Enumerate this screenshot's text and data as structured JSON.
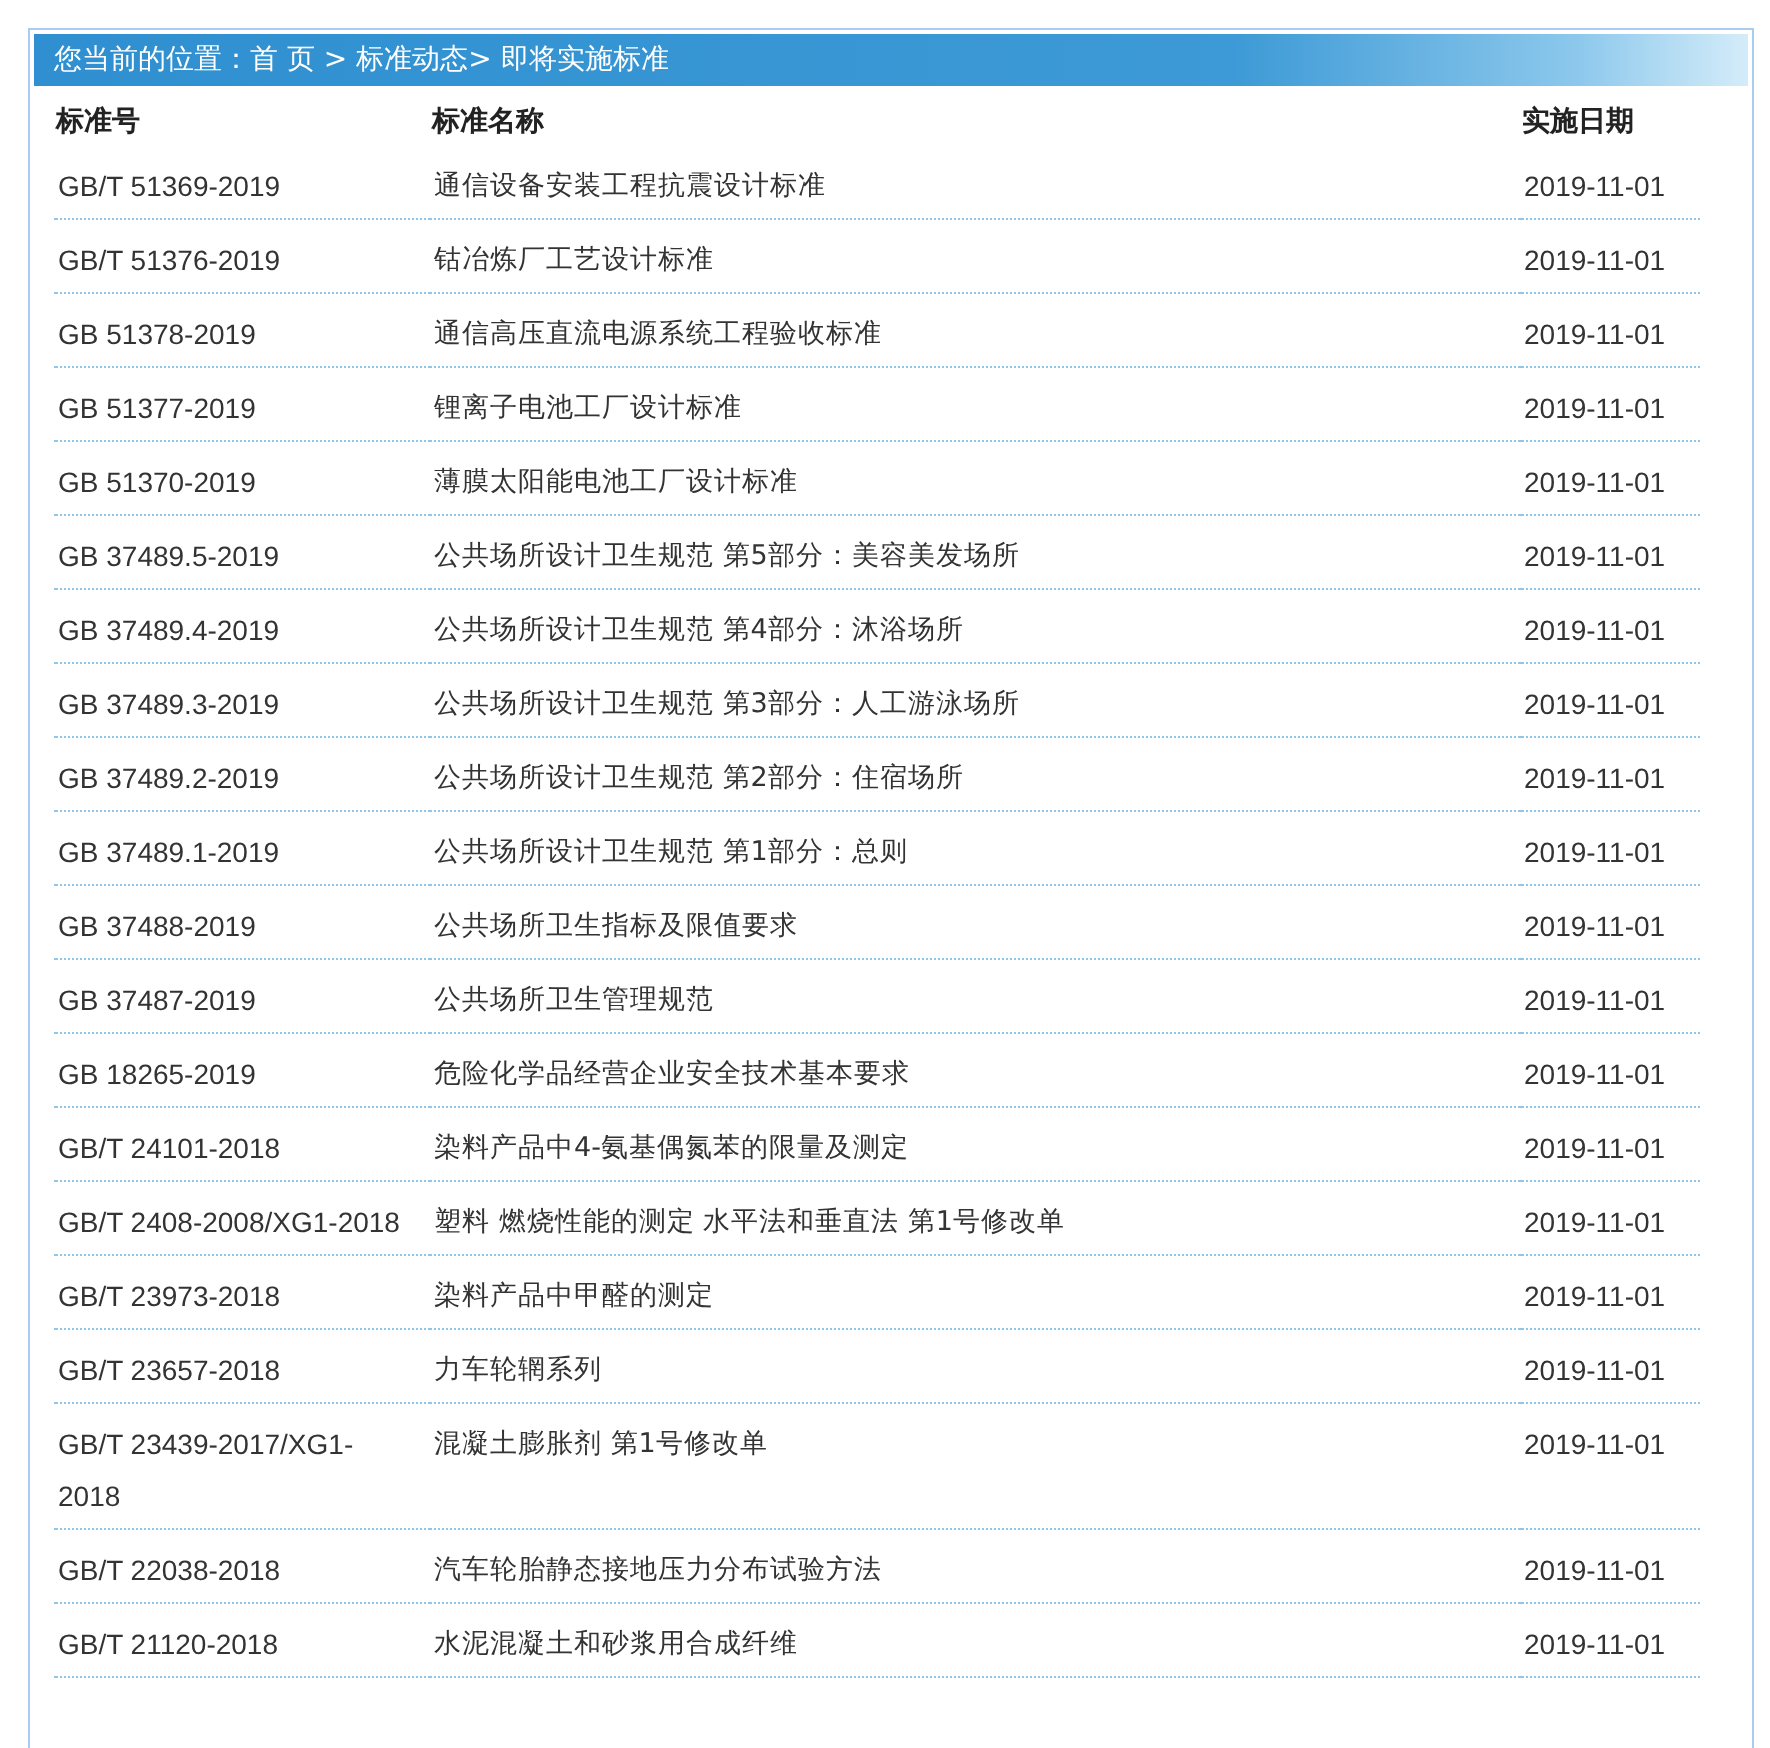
{
  "breadcrumb": "您当前的位置：首 页 > 标准动态> 即将实施标准",
  "table": {
    "columns": [
      "标准号",
      "标准名称",
      "实施日期"
    ],
    "rows": [
      [
        "GB/T 51369-2019",
        "通信设备安装工程抗震设计标准",
        "2019-11-01"
      ],
      [
        "GB/T 51376-2019",
        "钴冶炼厂工艺设计标准",
        "2019-11-01"
      ],
      [
        "GB 51378-2019",
        "通信高压直流电源系统工程验收标准",
        "2019-11-01"
      ],
      [
        "GB 51377-2019",
        "锂离子电池工厂设计标准",
        "2019-11-01"
      ],
      [
        "GB 51370-2019",
        "薄膜太阳能电池工厂设计标准",
        "2019-11-01"
      ],
      [
        "GB 37489.5-2019",
        "公共场所设计卫生规范 第5部分：美容美发场所",
        "2019-11-01"
      ],
      [
        "GB 37489.4-2019",
        "公共场所设计卫生规范 第4部分：沐浴场所",
        "2019-11-01"
      ],
      [
        "GB 37489.3-2019",
        "公共场所设计卫生规范 第3部分：人工游泳场所",
        "2019-11-01"
      ],
      [
        "GB 37489.2-2019",
        "公共场所设计卫生规范 第2部分：住宿场所",
        "2019-11-01"
      ],
      [
        "GB 37489.1-2019",
        "公共场所设计卫生规范 第1部分：总则",
        "2019-11-01"
      ],
      [
        "GB 37488-2019",
        "公共场所卫生指标及限值要求",
        "2019-11-01"
      ],
      [
        "GB 37487-2019",
        "公共场所卫生管理规范",
        "2019-11-01"
      ],
      [
        "GB 18265-2019",
        "危险化学品经营企业安全技术基本要求",
        "2019-11-01"
      ],
      [
        "GB/T 24101-2018",
        "染料产品中4-氨基偶氮苯的限量及测定",
        "2019-11-01"
      ],
      [
        "GB/T 2408-2008/XG1-2018",
        "塑料 燃烧性能的测定 水平法和垂直法 第1号修改单",
        "2019-11-01"
      ],
      [
        "GB/T 23973-2018",
        "染料产品中甲醛的测定",
        "2019-11-01"
      ],
      [
        "GB/T 23657-2018",
        "力车轮辋系列",
        "2019-11-01"
      ],
      [
        "GB/T 23439-2017/XG1-2018",
        "混凝土膨胀剂 第1号修改单",
        "2019-11-01"
      ],
      [
        "GB/T 22038-2018",
        "汽车轮胎静态接地压力分布试验方法",
        "2019-11-01"
      ],
      [
        "GB/T 21120-2018",
        "水泥混凝土和砂浆用合成纤维",
        "2019-11-01"
      ]
    ]
  }
}
